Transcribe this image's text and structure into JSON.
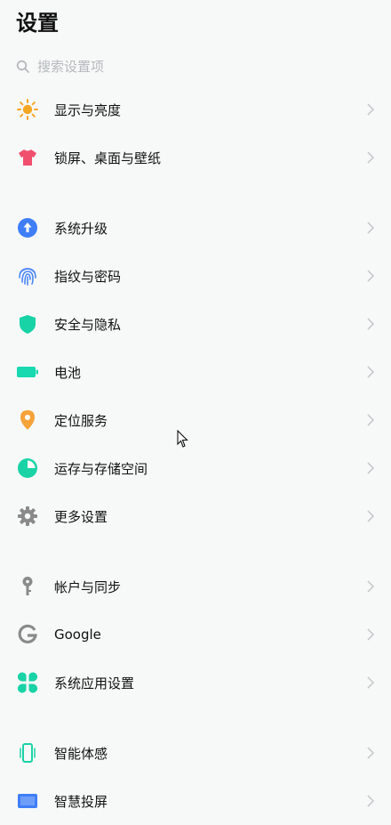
{
  "header": {
    "title": "设置"
  },
  "search": {
    "placeholder": "搜索设置项",
    "icon": "search-icon"
  },
  "colors": {
    "display": "#f5a623",
    "lockscreen": "#f0506e",
    "upgrade": "#3f7ef7",
    "fingerprint": "#4a85f6",
    "security": "#18d3a6",
    "battery": "#18d9b0",
    "location": "#f5a33a",
    "storage": "#19d3a6",
    "gray": "#8a8a8a",
    "screencast": "#3f7ef7",
    "chevron": "#c8cacc"
  },
  "groups": [
    {
      "items": [
        {
          "label": "显示与亮度",
          "icon": "sun-icon"
        },
        {
          "label": "锁屏、桌面与壁纸",
          "icon": "tshirt-icon"
        }
      ]
    },
    {
      "items": [
        {
          "label": "系统升级",
          "icon": "upgrade-arrow-icon"
        },
        {
          "label": "指纹与密码",
          "icon": "fingerprint-icon"
        },
        {
          "label": "安全与隐私",
          "icon": "shield-icon"
        },
        {
          "label": "电池",
          "icon": "battery-icon"
        },
        {
          "label": "定位服务",
          "icon": "location-pin-icon"
        },
        {
          "label": "运存与存储空间",
          "icon": "pie-chart-icon"
        },
        {
          "label": "更多设置",
          "icon": "gear-icon"
        }
      ]
    },
    {
      "items": [
        {
          "label": "帐户与同步",
          "icon": "key-icon"
        },
        {
          "label": "Google",
          "icon": "google-icon"
        },
        {
          "label": "系统应用设置",
          "icon": "clover-icon"
        }
      ]
    },
    {
      "items": [
        {
          "label": "智能体感",
          "icon": "phone-sense-icon"
        },
        {
          "label": "智慧投屏",
          "icon": "screencast-icon"
        }
      ]
    }
  ]
}
